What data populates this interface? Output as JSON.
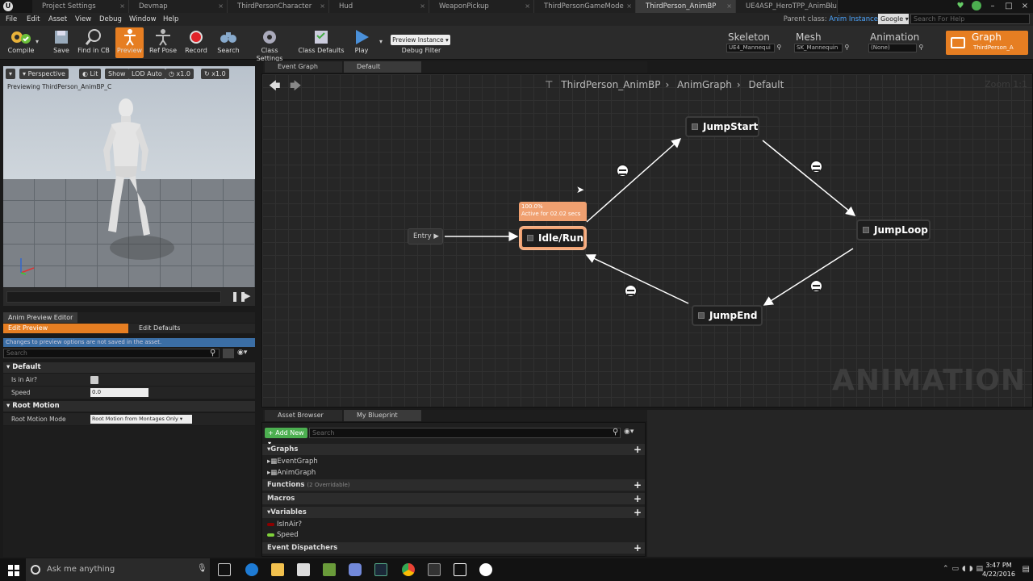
{
  "tabs": [
    {
      "label": "Project Settings"
    },
    {
      "label": "Devmap"
    },
    {
      "label": "ThirdPersonCharacter"
    },
    {
      "label": "Hud"
    },
    {
      "label": "WeaponPickup"
    },
    {
      "label": "ThirdPersonGameMode"
    },
    {
      "label": "ThirdPerson_AnimBP"
    },
    {
      "label": "UE4ASP_HeroTPP_AnimBlue"
    }
  ],
  "menu": [
    "File",
    "Edit",
    "Asset",
    "View",
    "Debug",
    "Window",
    "Help"
  ],
  "parent_class": {
    "label": "Parent class:",
    "value": "Anim Instance"
  },
  "search_combo": "Google",
  "help_search_placeholder": "Search For Help",
  "toolbar": {
    "compile": "Compile",
    "save": "Save",
    "find": "Find in CB",
    "preview": "Preview",
    "refpose": "Ref Pose",
    "record": "Record",
    "search": "Search",
    "class_settings": "Class Settings",
    "class_defaults": "Class Defaults",
    "play": "Play",
    "preview_instance": "Preview Instance",
    "debug_filter": "Debug Filter"
  },
  "modes": {
    "skeleton": {
      "title": "Skeleton",
      "field": "UE4_Mannequi"
    },
    "mesh": {
      "title": "Mesh",
      "field": "SK_Mannequin"
    },
    "animation": {
      "title": "Animation",
      "field": "(None)"
    },
    "graph": {
      "title": "Graph",
      "field": "ThirdPerson_A"
    }
  },
  "viewport": {
    "perspective": "Perspective",
    "lit": "Lit",
    "show": "Show",
    "lod": "LOD Auto",
    "speed1": "x1.0",
    "speed2": "x1.0",
    "previewing": "Previewing ThirdPerson_AnimBP_C"
  },
  "anim_preview": {
    "header": "Anim Preview Editor",
    "edit_preview": "Edit Preview",
    "edit_defaults": "Edit Defaults",
    "warning": "Changes to preview options are not saved in the asset.",
    "search_placeholder": "Search",
    "default_section": "Default",
    "is_in_air_label": "Is in Air?",
    "speed_label": "Speed",
    "speed_value": "0.0",
    "root_motion_section": "Root Motion",
    "root_motion_mode_label": "Root Motion Mode",
    "root_motion_mode_value": "Root Motion from Montages Only"
  },
  "graph": {
    "tab_event": "Event Graph",
    "tab_default": "Default",
    "breadcrumb": [
      "ThirdPerson_AnimBP",
      "AnimGraph",
      "Default"
    ],
    "zoom": "Zoom 1:1",
    "watermark": "ANIMATION",
    "entry": "Entry",
    "active_label_1": "100.0%",
    "active_label_2": "Active for 02.02 secs",
    "states": {
      "idle": "Idle/Run",
      "jumpstart": "JumpStart",
      "jumploop": "JumpLoop",
      "jumpend": "JumpEnd"
    }
  },
  "blueprint": {
    "tab_asset": "Asset Browser",
    "tab_my": "My Blueprint",
    "add_new": "+ Add New",
    "search_placeholder": "Search",
    "graphs": "Graphs",
    "event_graph": "EventGraph",
    "anim_graph": "AnimGraph",
    "functions": "Functions",
    "functions_note": "(2 Overridable)",
    "macros": "Macros",
    "variables": "Variables",
    "var1": "IsInAir?",
    "var2": "Speed",
    "dispatchers": "Event Dispatchers",
    "var1_color": "#8b0000",
    "var2_color": "#7fd13b"
  },
  "taskbar": {
    "ask": "Ask me anything",
    "time": "3:47 PM",
    "date": "4/22/2016"
  },
  "colors": {
    "accent": "#e67e22",
    "active_state": "#f0a070"
  }
}
